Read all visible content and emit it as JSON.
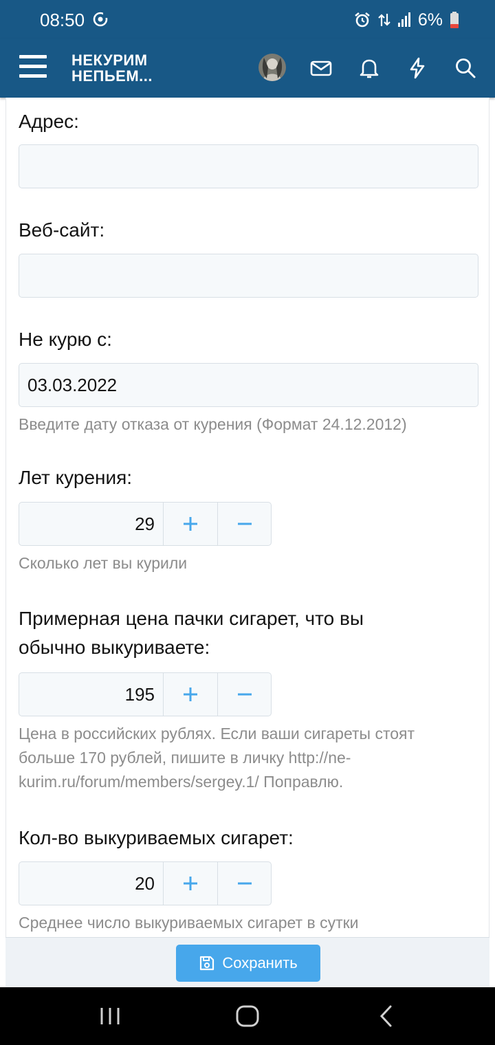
{
  "status_bar": {
    "time": "08:50",
    "battery_percent": "6%",
    "icons": [
      "sync-icon",
      "alarm-icon",
      "data-arrows-icon",
      "signal-icon",
      "battery-low-icon"
    ]
  },
  "header": {
    "logo_line1": "НЕКУРИМ",
    "logo_line2": "НЕПЬЕМ...",
    "icons": [
      "menu-icon",
      "avatar",
      "mail-icon",
      "bell-icon",
      "bolt-icon",
      "search-icon"
    ]
  },
  "form": {
    "address": {
      "label": "Адрес:",
      "value": ""
    },
    "website": {
      "label": "Веб-сайт:",
      "value": ""
    },
    "quit_date": {
      "label": "Не курю с:",
      "value": "03.03.2022",
      "hint": "Введите дату отказа от курения (Формат 24.12.2012)"
    },
    "years_smoking": {
      "label": "Лет курения:",
      "value": "29",
      "hint": "Сколько лет вы курили"
    },
    "pack_price": {
      "label_line1": "Примерная цена пачки сигарет, что вы",
      "label_line2": "обычно выкуриваете:",
      "value": "195",
      "hint_line1": "Цена в российских рублях. Если ваши сигареты стоят",
      "hint_line2": "больше 170 рублей, пишите в личку http://ne-",
      "hint_line3": "kurim.ru/forum/members/sergey.1/ Поправлю."
    },
    "cigarettes_count": {
      "label": "Кол-во выкуриваемых сигарет:",
      "value": "20",
      "hint": "Среднее число выкуриваемых сигарет в сутки"
    }
  },
  "footer": {
    "save_label": "Сохранить"
  },
  "colors": {
    "header_bg": "#185886",
    "accent": "#47a7eb",
    "input_bg": "#f6f9fb",
    "hint_text": "#8c8c8c"
  }
}
